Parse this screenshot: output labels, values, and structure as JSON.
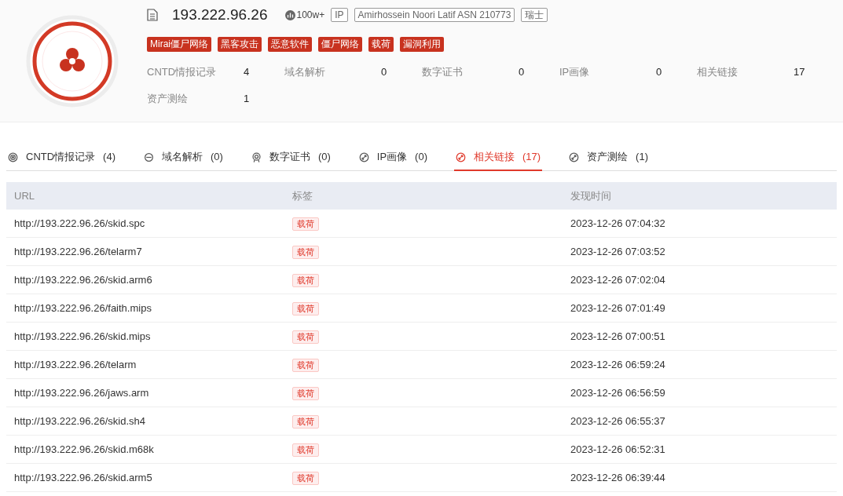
{
  "header": {
    "ip": "193.222.96.26",
    "popularity": "100w+",
    "badges": [
      "IP",
      "Amirhossein Noori Latif ASN 210773",
      "瑞士"
    ],
    "tags": [
      "Mirai僵尸网络",
      "黑客攻击",
      "恶意软件",
      "僵尸网络",
      "载荷",
      "漏洞利用"
    ],
    "stats": [
      {
        "label": "CNTD情报记录",
        "value": "4"
      },
      {
        "label": "域名解析",
        "value": "0"
      },
      {
        "label": "数字证书",
        "value": "0"
      },
      {
        "label": "IP画像",
        "value": "0"
      },
      {
        "label": "相关链接",
        "value": "17"
      },
      {
        "label": "资产测绘",
        "value": "1"
      }
    ]
  },
  "tabs": [
    {
      "kind": "intel",
      "label": "CNTD情报记录",
      "count": "(4)",
      "selected": false
    },
    {
      "kind": "domain",
      "label": "域名解析",
      "count": "(0)",
      "selected": false
    },
    {
      "kind": "cert",
      "label": "数字证书",
      "count": "(0)",
      "selected": false
    },
    {
      "kind": "link",
      "label": "IP画像",
      "count": "(0)",
      "selected": false
    },
    {
      "kind": "link",
      "label": "相关链接",
      "count": "(17)",
      "selected": true
    },
    {
      "kind": "link",
      "label": "资产测绘",
      "count": "(1)",
      "selected": false
    }
  ],
  "table": {
    "columns": [
      "URL",
      "标签",
      "发现时间"
    ],
    "rows": [
      {
        "url": "http://193.222.96.26/skid.spc",
        "tag": "载荷",
        "time": "2023-12-26 07:04:32"
      },
      {
        "url": "http://193.222.96.26/telarm7",
        "tag": "载荷",
        "time": "2023-12-26 07:03:52"
      },
      {
        "url": "http://193.222.96.26/skid.arm6",
        "tag": "载荷",
        "time": "2023-12-26 07:02:04"
      },
      {
        "url": "http://193.222.96.26/faith.mips",
        "tag": "载荷",
        "time": "2023-12-26 07:01:49"
      },
      {
        "url": "http://193.222.96.26/skid.mips",
        "tag": "载荷",
        "time": "2023-12-26 07:00:51"
      },
      {
        "url": "http://193.222.96.26/telarm",
        "tag": "载荷",
        "time": "2023-12-26 06:59:24"
      },
      {
        "url": "http://193.222.96.26/jaws.arm",
        "tag": "载荷",
        "time": "2023-12-26 06:56:59"
      },
      {
        "url": "http://193.222.96.26/skid.sh4",
        "tag": "载荷",
        "time": "2023-12-26 06:55:37"
      },
      {
        "url": "http://193.222.96.26/skid.m68k",
        "tag": "载荷",
        "time": "2023-12-26 06:52:31"
      },
      {
        "url": "http://193.222.96.26/skid.arm5",
        "tag": "载荷",
        "time": "2023-12-26 06:39:44"
      }
    ]
  }
}
